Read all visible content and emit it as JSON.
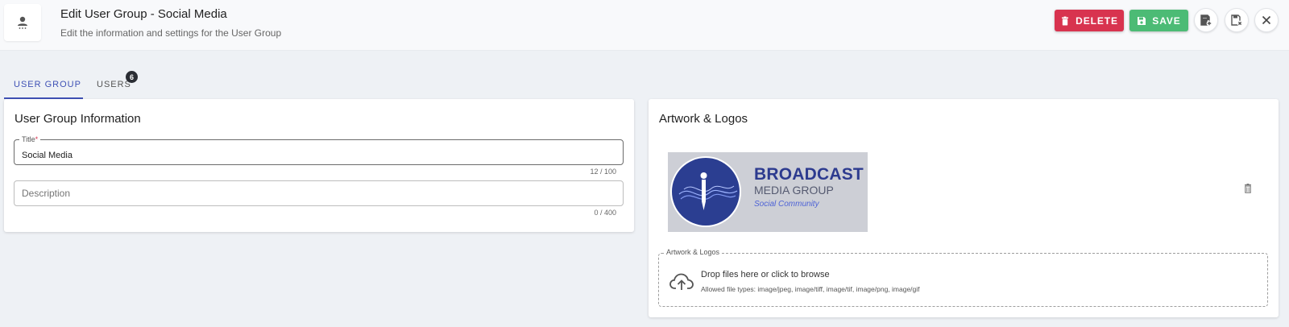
{
  "header": {
    "title": "Edit User Group - Social Media",
    "subtitle": "Edit the information and settings for the User Group",
    "delete_label": "DELETE",
    "save_label": "SAVE",
    "accent_delete": "#d8334f",
    "accent_save": "#4cbb75"
  },
  "tabs": [
    {
      "label": "USER GROUP",
      "active": true
    },
    {
      "label": "USERS",
      "badge": "6"
    }
  ],
  "info_card": {
    "title": "User Group Information",
    "title_field": {
      "label": "Title",
      "required_mark": "*",
      "value": "Social Media",
      "counter": "12 / 100"
    },
    "description_field": {
      "placeholder": "Description",
      "value": "",
      "counter": "0 / 400"
    }
  },
  "artwork_card": {
    "title": "Artwork & Logos",
    "logo": {
      "line1": "BROADCAST",
      "line2": "MEDIA GROUP",
      "line3": "Social Community"
    },
    "dropzone": {
      "legend": "Artwork & Logos",
      "main_text": "Drop files here or click to browse",
      "sub_text": "Allowed file types: image/jpeg, image/tiff, image/tif, image/png, image/gif"
    }
  }
}
